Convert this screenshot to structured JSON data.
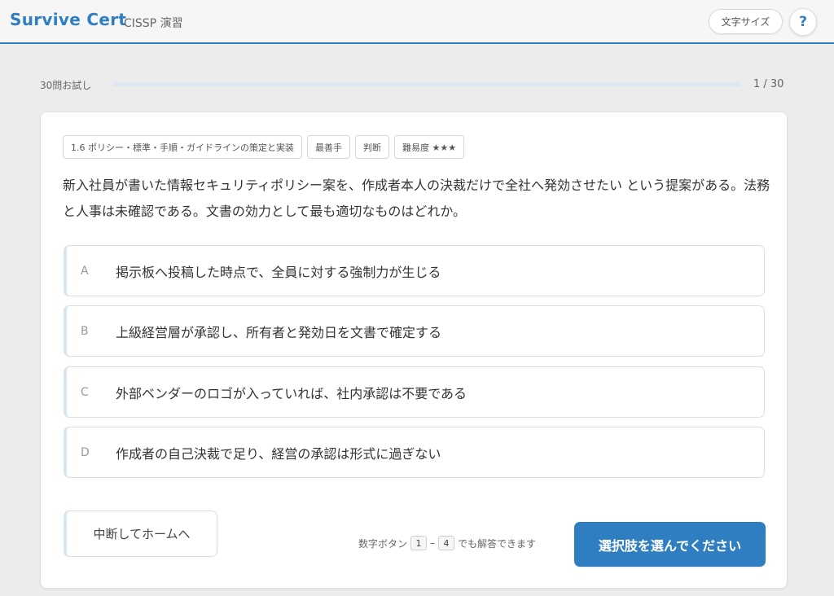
{
  "header": {
    "brand": "Survive Cert",
    "subtitle": "CISSP 演習",
    "font_size_label": "文字サイズ",
    "help_label": "?"
  },
  "progress": {
    "label": "30問お試し",
    "count": "1 / 30",
    "fraction": 0.0
  },
  "question": {
    "tags": [
      "1.6 ポリシー・標準・手順・ガイドラインの策定と実装",
      "最善手",
      "判断",
      "難易度 ★★★"
    ],
    "text": "新入社員が書いた情報セキュリティポリシー案を、作成者本人の決裁だけで全社へ発効させたい という提案がある。法務と人事は未確認である。文書の効力として最も適切なものはどれか。",
    "options": [
      {
        "letter": "A",
        "text": "掲示板へ投稿した時点で、全員に対する強制力が生じる"
      },
      {
        "letter": "B",
        "text": "上級経営層が承認し、所有者と発効日を文書で確定する"
      },
      {
        "letter": "C",
        "text": "外部ベンダーのロゴが入っていれば、社内承認は不要である"
      },
      {
        "letter": "D",
        "text": "作成者の自己決裁で足り、経営の承認は形式に過ぎない"
      }
    ]
  },
  "footer": {
    "quit_label": "中断してホームへ",
    "hint_prefix": "数字ボタン",
    "hint_key_start": "1",
    "hint_separator": "–",
    "hint_key_end": "4",
    "hint_suffix": "でも解答できます",
    "submit_label": "選択肢を選んでください"
  },
  "colors": {
    "accent": "#2f7ec1",
    "background": "#ececec"
  }
}
